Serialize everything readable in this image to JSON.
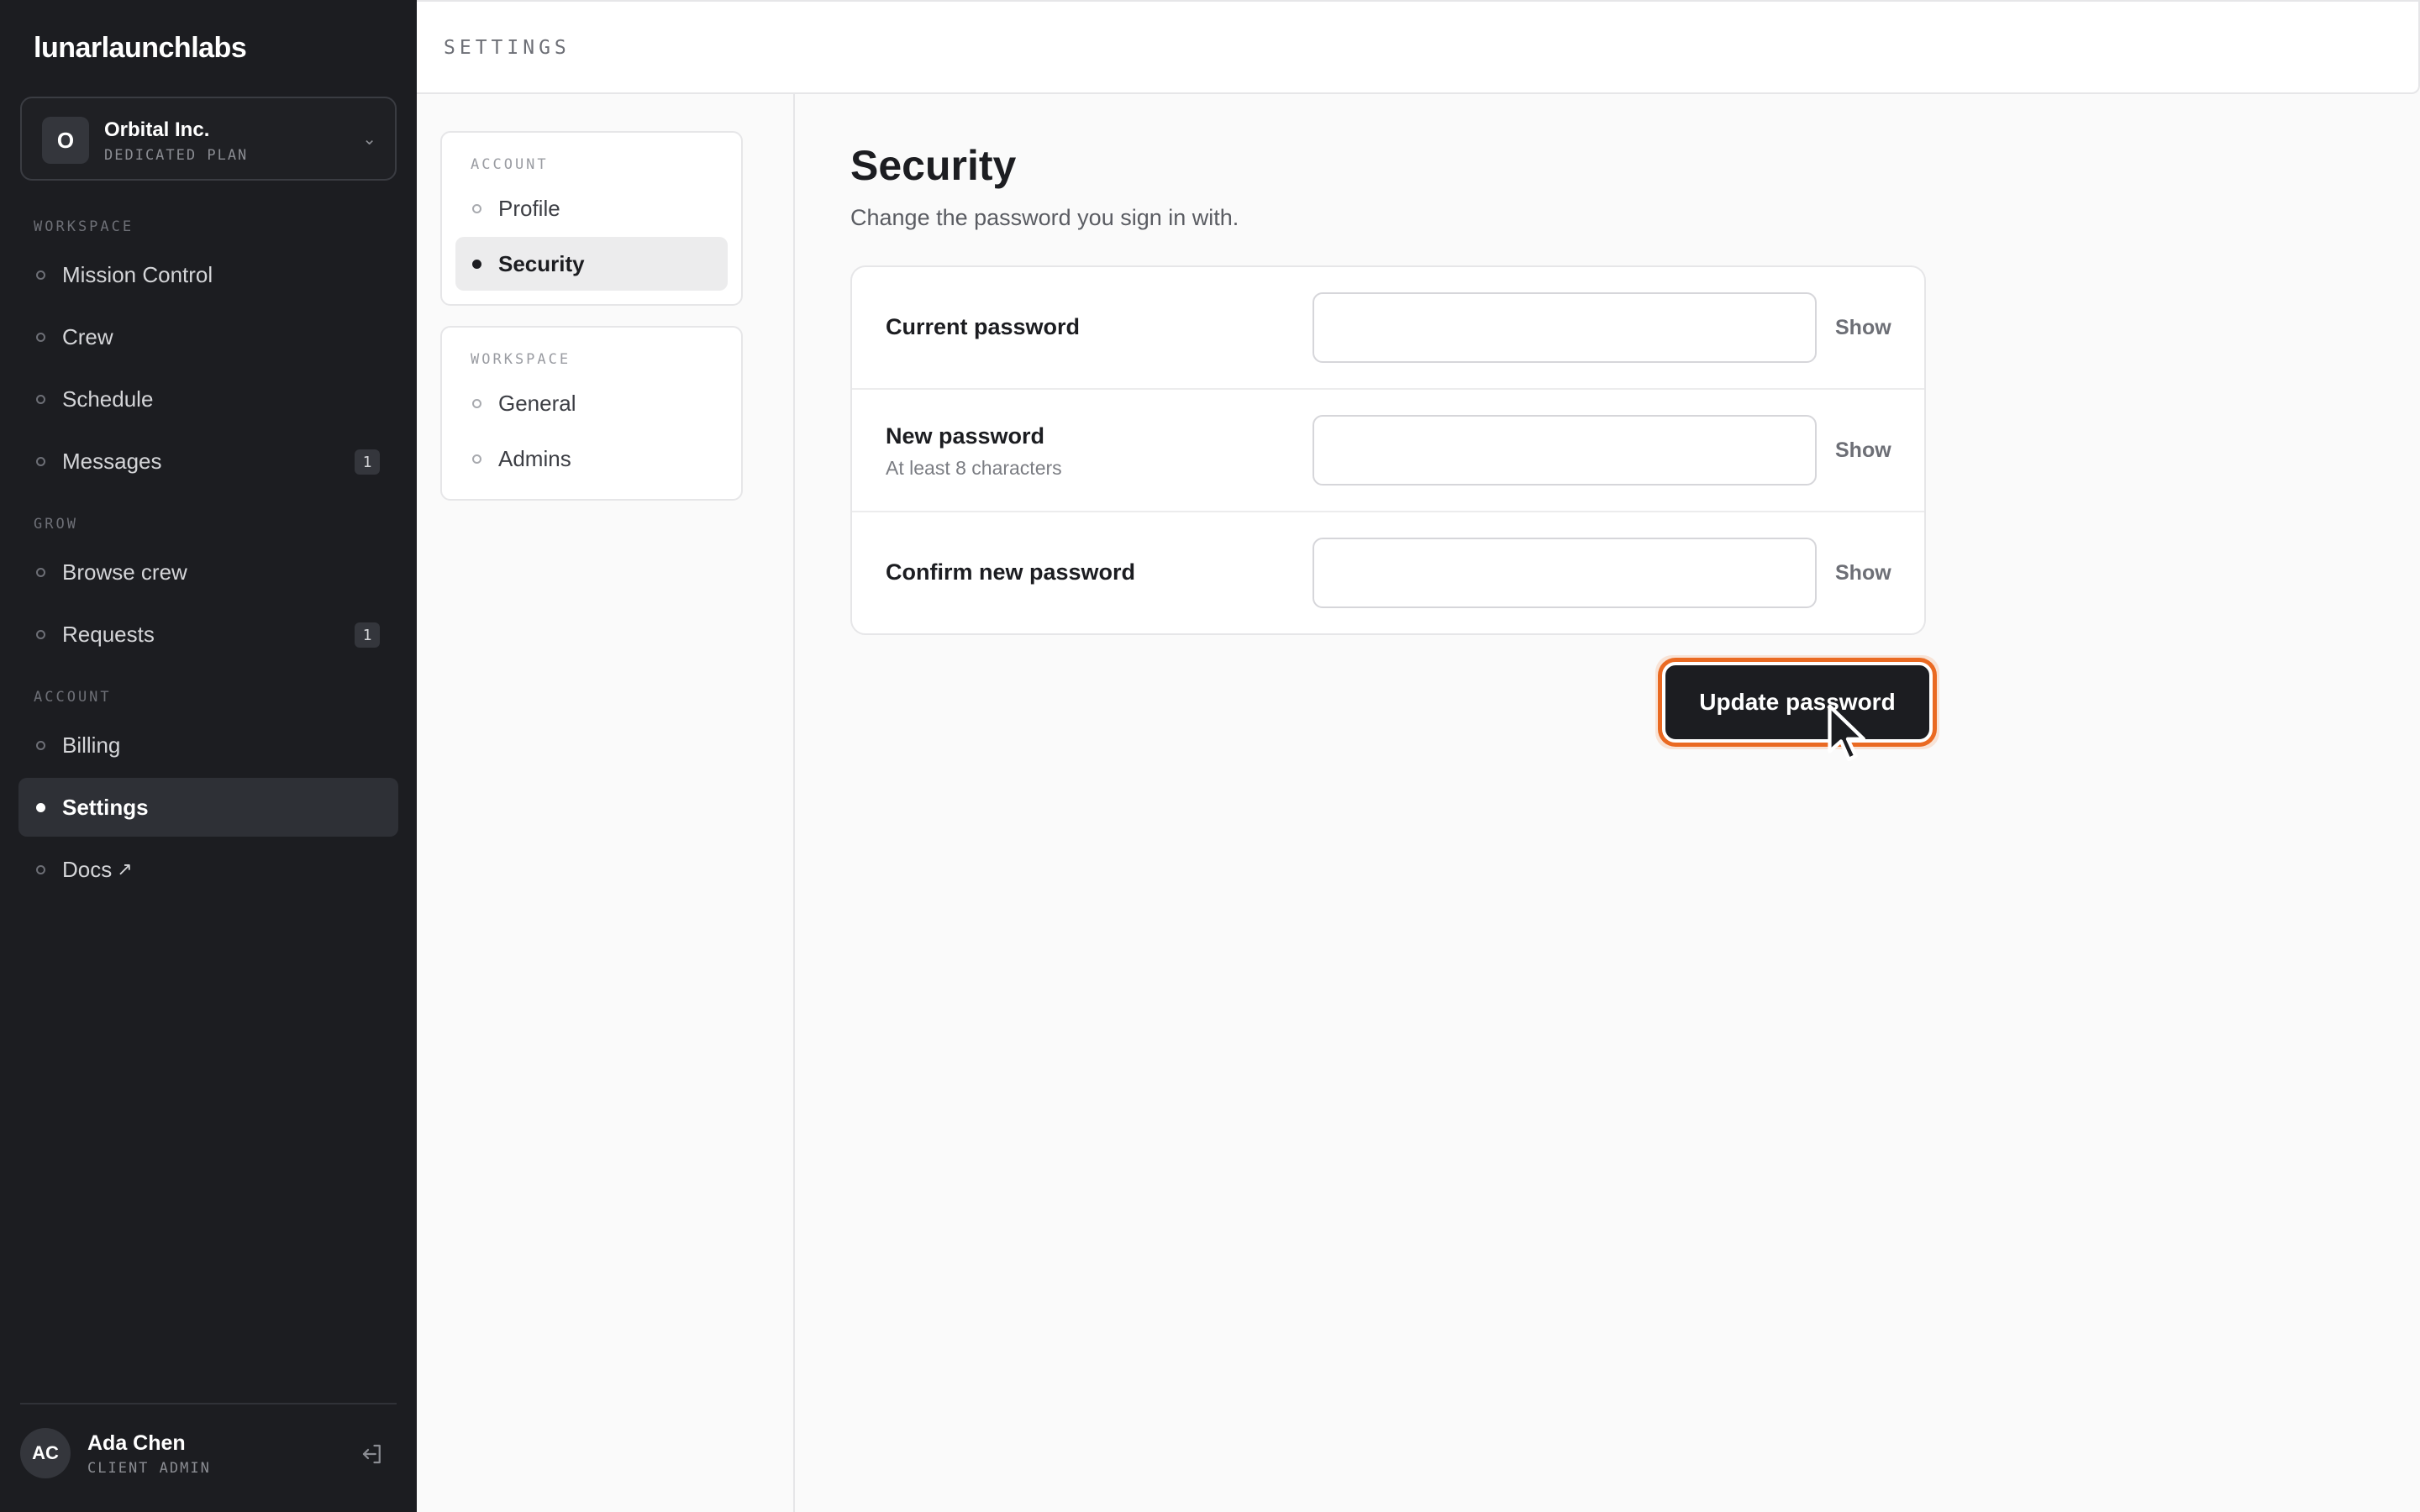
{
  "app": {
    "logo": "lunarlaunchlabs"
  },
  "org": {
    "initial": "O",
    "name": "Orbital Inc.",
    "plan": "DEDICATED PLAN",
    "chevron_icon": "chevron-down-icon"
  },
  "sidebar": {
    "sections": [
      {
        "heading": "WORKSPACE"
      },
      {
        "heading": "GROW"
      },
      {
        "heading": "ACCOUNT"
      }
    ],
    "items": [
      {
        "label": "Mission Control"
      },
      {
        "label": "Crew"
      },
      {
        "label": "Schedule"
      },
      {
        "label": "Messages",
        "badge": "1"
      },
      {
        "label": "Browse crew"
      },
      {
        "label": "Requests",
        "badge": "1"
      },
      {
        "label": "Billing"
      },
      {
        "label": "Settings",
        "active": true
      },
      {
        "label": "Docs",
        "external_icon": "↗"
      }
    ]
  },
  "user": {
    "initials": "AC",
    "name": "Ada Chen",
    "role": "CLIENT ADMIN",
    "logout_icon": "logout-icon"
  },
  "topbar": {
    "title": "SETTINGS"
  },
  "subnav": {
    "groups": [
      {
        "heading": "ACCOUNT",
        "items": [
          {
            "label": "Profile"
          },
          {
            "label": "Security",
            "active": true
          }
        ]
      },
      {
        "heading": "WORKSPACE",
        "items": [
          {
            "label": "General"
          },
          {
            "label": "Admins"
          }
        ]
      }
    ]
  },
  "security": {
    "title": "Security",
    "subtitle": "Change the password you sign in with.",
    "fields": [
      {
        "label": "Current password",
        "hint": "",
        "value": "",
        "show_label": "Show"
      },
      {
        "label": "New password",
        "hint": "At least 8 characters",
        "value": "",
        "show_label": "Show"
      },
      {
        "label": "Confirm new password",
        "hint": "",
        "value": "",
        "show_label": "Show"
      }
    ],
    "submit_label": "Update password"
  },
  "colors": {
    "sidebar_bg": "#1c1d21",
    "accent_focus": "#ea6a22",
    "button_bg": "#1c1d21"
  }
}
